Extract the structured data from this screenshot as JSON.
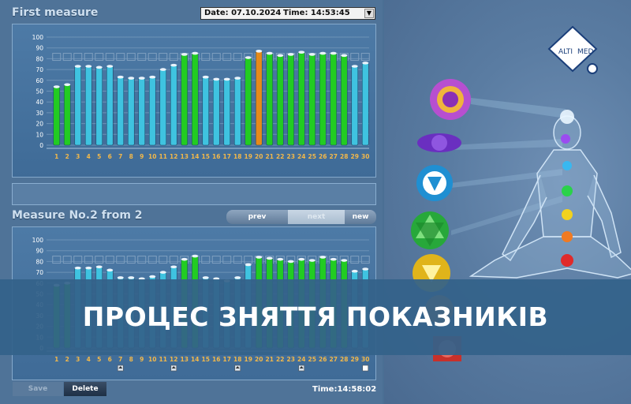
{
  "header": {
    "first_title": "First measure",
    "date_text": "Date: 07.10.2024",
    "time_text": "Time: 14:53:45",
    "dropdown_arrow": "▼"
  },
  "second": {
    "title": "Measure No.2 from 2"
  },
  "nav": {
    "prev": "prev",
    "next": "next",
    "new": "new"
  },
  "buttons": {
    "save": "Save",
    "delete": "Delete"
  },
  "footer_time": "Time:14:58:02",
  "banner": "ПРОЦЕС ЗНЯТТЯ ПОКАЗНИКІВ",
  "logo": {
    "line1": "ALTI",
    "line2": "MED"
  },
  "colors": {
    "cyan": "#3fc3e0",
    "green": "#22cc22",
    "orange": "#e68a1a",
    "ref_box": "#7f9fbf"
  },
  "chart_data": [
    {
      "type": "bar",
      "categories": [
        "1",
        "2",
        "3",
        "4",
        "5",
        "6",
        "7",
        "8",
        "9",
        "10",
        "11",
        "12",
        "13",
        "14",
        "15",
        "16",
        "17",
        "18",
        "19",
        "20",
        "21",
        "22",
        "23",
        "24",
        "25",
        "26",
        "27",
        "28",
        "29",
        "30"
      ],
      "values": [
        54,
        56,
        73,
        73,
        72,
        73,
        63,
        62,
        62,
        63,
        70,
        74,
        84,
        85,
        63,
        61,
        61,
        62,
        81,
        87,
        85,
        83,
        84,
        86,
        84,
        85,
        85,
        83,
        73,
        76
      ],
      "bar_colors": [
        "green",
        "green",
        "cyan",
        "cyan",
        "cyan",
        "cyan",
        "cyan",
        "cyan",
        "cyan",
        "cyan",
        "cyan",
        "cyan",
        "green",
        "green",
        "cyan",
        "cyan",
        "cyan",
        "cyan",
        "green",
        "orange",
        "green",
        "green",
        "green",
        "green",
        "green",
        "green",
        "green",
        "green",
        "cyan",
        "cyan"
      ],
      "yticks": [
        "100",
        "90",
        "80",
        "70",
        "60",
        "50",
        "40",
        "30",
        "20",
        "10",
        "0"
      ],
      "ylim": [
        0,
        100
      ],
      "grid": true
    },
    {
      "type": "bar",
      "categories": [
        "1",
        "2",
        "3",
        "4",
        "5",
        "6",
        "7",
        "8",
        "9",
        "10",
        "11",
        "12",
        "13",
        "14",
        "15",
        "16",
        "17",
        "18",
        "19",
        "20",
        "21",
        "22",
        "23",
        "24",
        "25",
        "26",
        "27",
        "28",
        "29",
        "30"
      ],
      "values": [
        58,
        60,
        74,
        74,
        75,
        72,
        65,
        65,
        64,
        66,
        70,
        75,
        82,
        85,
        65,
        64,
        62,
        65,
        77,
        84,
        83,
        82,
        80,
        82,
        81,
        84,
        82,
        81,
        71,
        73
      ],
      "bar_colors": [
        "green",
        "green",
        "cyan",
        "cyan",
        "cyan",
        "cyan",
        "cyan",
        "cyan",
        "cyan",
        "cyan",
        "cyan",
        "cyan",
        "green",
        "green",
        "cyan",
        "cyan",
        "cyan",
        "cyan",
        "cyan",
        "green",
        "green",
        "green",
        "green",
        "green",
        "green",
        "green",
        "green",
        "green",
        "cyan",
        "cyan"
      ],
      "yticks": [
        "100",
        "90",
        "80",
        "70",
        "60",
        "50",
        "40",
        "30",
        "20",
        "10",
        "0"
      ],
      "ylim": [
        0,
        100
      ],
      "grid": true,
      "up_markers_at": [
        "7",
        "12",
        "18",
        "24",
        "30"
      ]
    }
  ]
}
